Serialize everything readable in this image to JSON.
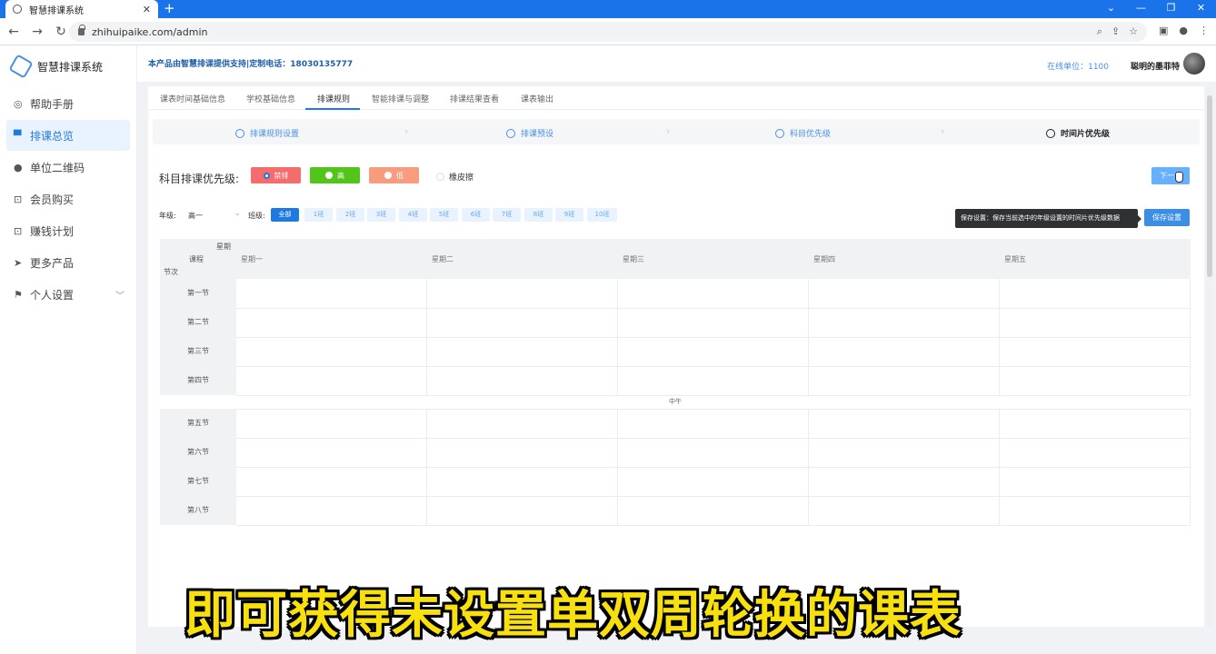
{
  "browser": {
    "tab_title": "智慧排课系统",
    "url": "zhihuipaike.com/admin"
  },
  "app": {
    "logo_text": "智慧排课系统",
    "notice": "本产品由智慧排课提供支持|定制电话：18030135777",
    "online": "在线单位：1100",
    "username": "聪明的墨菲特"
  },
  "sidebar": {
    "items": [
      {
        "label": "帮助手册",
        "icon": "help-icon"
      },
      {
        "label": "排课总览",
        "icon": "monitor-icon"
      },
      {
        "label": "单位二维码",
        "icon": "user-icon"
      },
      {
        "label": "会员购买",
        "icon": "cart-icon"
      },
      {
        "label": "赚钱计划",
        "icon": "cart-icon"
      },
      {
        "label": "更多产品",
        "icon": "send-icon"
      },
      {
        "label": "个人设置",
        "icon": "flag-icon"
      }
    ]
  },
  "nav_tabs": [
    "课表时间基础信息",
    "学校基础信息",
    "排课规则",
    "智能排课与调整",
    "排课结果查看",
    "课表输出"
  ],
  "steps": [
    "排课规则设置",
    "排课预设",
    "科目优先级",
    "时间片优先级"
  ],
  "priority": {
    "label": "科目排课优先级:",
    "buttons": [
      {
        "label": "禁排",
        "color": "#f56c6c"
      },
      {
        "label": "高",
        "color": "#52c41a"
      },
      {
        "label": "低",
        "color": "#f89c7e"
      }
    ],
    "eraser": "橡皮擦",
    "next": "下一步"
  },
  "filters": {
    "grade_label": "年级:",
    "grade_value": "高一",
    "class_label": "班级:",
    "classes": [
      "全部",
      "1班",
      "2班",
      "3班",
      "4班",
      "5班",
      "6班",
      "7班",
      "8班",
      "9班",
      "10班"
    ]
  },
  "tooltip": "保存设置：保存当前选中的年级设置的时间片优先级数据",
  "save": "保存设置",
  "table": {
    "corner_top": "星期",
    "corner_mid": "课程",
    "corner_bottom": "节次",
    "days": [
      "星期一",
      "星期二",
      "星期三",
      "星期四",
      "星期五"
    ],
    "periods_am": [
      "第一节",
      "第二节",
      "第三节",
      "第四节"
    ],
    "noon": "中午",
    "periods_pm": [
      "第五节",
      "第六节",
      "第七节",
      "第八节"
    ]
  },
  "subtitle": "即可获得未设置单双周轮换的课表"
}
